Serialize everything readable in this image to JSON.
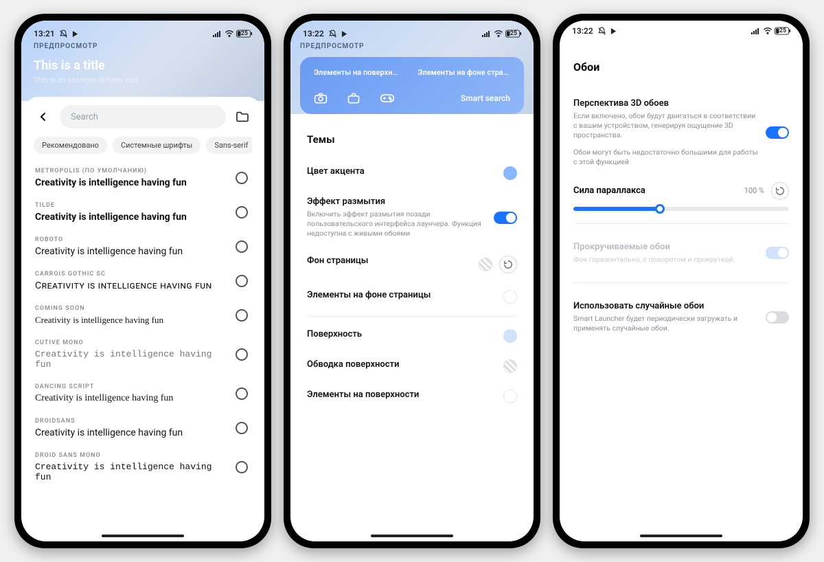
{
  "status": {
    "time1": "13:21",
    "time2": "13:22",
    "time3": "13:22",
    "battery": "25"
  },
  "p1": {
    "overline": "ПРЕДПРОСМОТР",
    "title": "This is a title",
    "sub": "This is an example of body text",
    "search_placeholder": "Search",
    "chips": [
      "Рекомендовано",
      "Системные шрифты",
      "Sans-serif"
    ],
    "sample": "Creativity is intelligence having fun",
    "fonts": [
      {
        "name": "METROPOLIS (ПО УМОЛЧАНИЮ)",
        "cls": "bold"
      },
      {
        "name": "TILDE",
        "cls": "bold"
      },
      {
        "name": "ROBOTO",
        "cls": ""
      },
      {
        "name": "CARROIS GOTHIC SC",
        "cls": "sc"
      },
      {
        "name": "COMING SOON",
        "cls": "hw1"
      },
      {
        "name": "CUTIVE MONO",
        "cls": "mono"
      },
      {
        "name": "DANCING SCRIPT",
        "cls": "script"
      },
      {
        "name": "DROIDSANS",
        "cls": ""
      },
      {
        "name": "DROID SANS MONO",
        "cls": "monoc"
      }
    ]
  },
  "p2": {
    "overline": "ПРЕДПРОСМОТР",
    "tab1": "Элементы на поверхности",
    "tab2": "Элементы на фоне страни...",
    "smart": "Smart search",
    "section": "Темы",
    "rows": {
      "accent": "Цвет акцента",
      "blur": "Эффект размытия",
      "blur_desc": "Включить эффект размытия позади пользовательского интерфейса лаунчера. Функция недоступна с живыми обоями",
      "page_bg": "Фон страницы",
      "on_page": "Элементы на фоне страницы",
      "surface": "Поверхность",
      "stroke": "Обводка поверхности",
      "on_surface": "Элементы на поверхности"
    }
  },
  "p3": {
    "title": "Обои",
    "persp": "Перспектива 3D обоев",
    "persp_desc": "Если включено, обои будут двигаться в соответствии с вашим устройством, генерируя ощущение 3D пространства.",
    "persp_note": "Обои могут быть недостаточно большими для работы с этой функцией",
    "parallax": "Сила параллакса",
    "parallax_val": "100 %",
    "scroll": "Прокручиваемые обои",
    "scroll_desc": "Фон горизонтально, с поворотом и прокруткой.",
    "random": "Использовать случайные обои",
    "random_desc": "Smart Launcher будет периодически загружать и применять случайные обои."
  }
}
